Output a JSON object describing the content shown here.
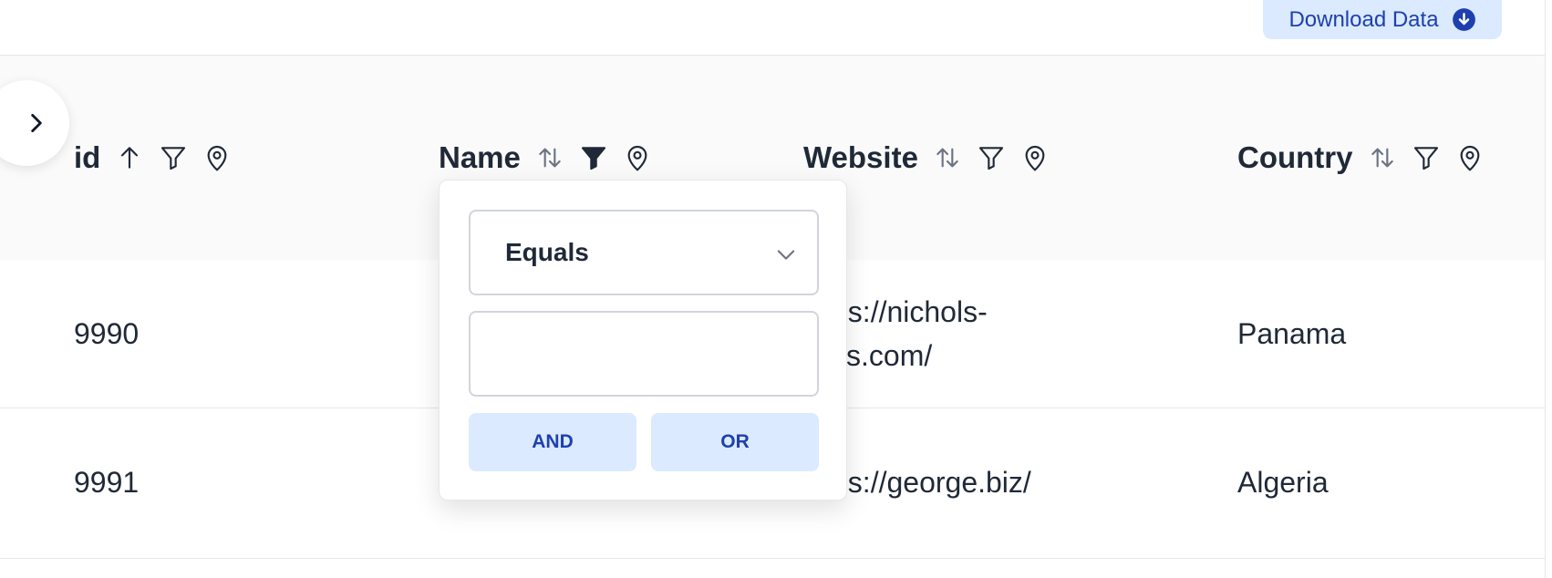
{
  "toolbar": {
    "download_label": "Download Data",
    "download_icon": "arrow-down-circle-icon"
  },
  "table": {
    "columns": [
      {
        "title": "id",
        "sort_icon": "arrow-up-icon",
        "filter_icon": "filter-outline-icon",
        "pin_icon": "location-pin-icon"
      },
      {
        "title": "Name",
        "sort_icon": "sort-arrows-icon",
        "filter_icon": "filter-filled-icon",
        "pin_icon": "location-pin-icon"
      },
      {
        "title": "Website",
        "sort_icon": "sort-arrows-icon",
        "filter_icon": "filter-outline-icon",
        "pin_icon": "location-pin-icon"
      },
      {
        "title": "Country",
        "sort_icon": "sort-arrows-icon",
        "filter_icon": "filter-outline-icon",
        "pin_icon": "location-pin-icon"
      }
    ],
    "rows": [
      {
        "id": "9990",
        "website_line1": "ps://nichols-",
        "website_line2": "ks.com/",
        "country": "Panama"
      },
      {
        "id": "9991",
        "website_line1": "ps://george.biz/",
        "country": "Algeria"
      }
    ]
  },
  "filter_popover": {
    "operator": "Equals",
    "value": "",
    "and_label": "AND",
    "or_label": "OR"
  },
  "colors": {
    "accent_bg": "#dbeafe",
    "accent_text": "#1e40af",
    "text": "#1f2937",
    "header_bg": "#fafafa",
    "border": "#e5e7eb"
  }
}
